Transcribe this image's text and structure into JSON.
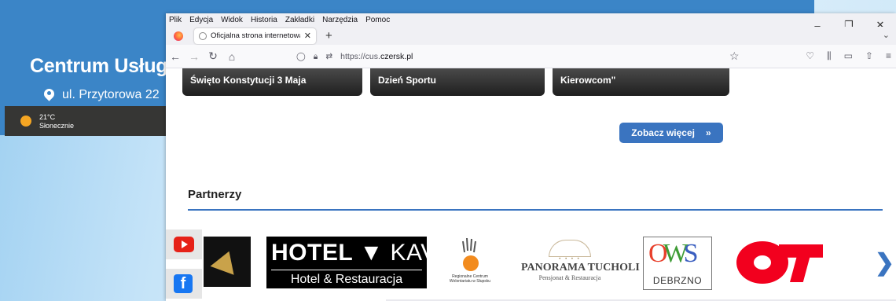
{
  "background_app": {
    "title": "Centrum Usług Spo",
    "address": "ul. Przytorowa 22",
    "weather": {
      "temp": "21°C",
      "condition": "Słonecznie"
    }
  },
  "browser": {
    "menu": [
      "Plik",
      "Edycja",
      "Widok",
      "Historia",
      "Zakładki",
      "Narzędzia",
      "Pomoc"
    ],
    "tab_title": "Oficjalna strona internetowa Ce",
    "url_prefix": "https://cus.",
    "url_domain": "czersk.pl",
    "window_controls": {
      "minimize": "–",
      "restore": "❐",
      "close": "✕"
    }
  },
  "page": {
    "event_cards": [
      "Święto Konstytucji 3 Maja",
      "Dzień Sportu",
      "Kierowcom\""
    ],
    "more_button": "Zobacz więcej",
    "more_arrow": "»",
    "partners_heading": "Partnerzy",
    "partners": {
      "kavka_name": "HOTEL",
      "kavka_brand": "KAVKA",
      "kavka_sub": "Hotel & Restauracja",
      "rcw_text": "Regionalne Centrum Wolontariatu w Słupsku",
      "panorama_title": "PANORAMA TUCHOLI",
      "panorama_sub": "Pensjonat & Restauracja",
      "ows_letters": [
        "O",
        "W",
        "S"
      ],
      "ows_city": "DEBRZNO"
    },
    "next_arrow": "❯"
  }
}
